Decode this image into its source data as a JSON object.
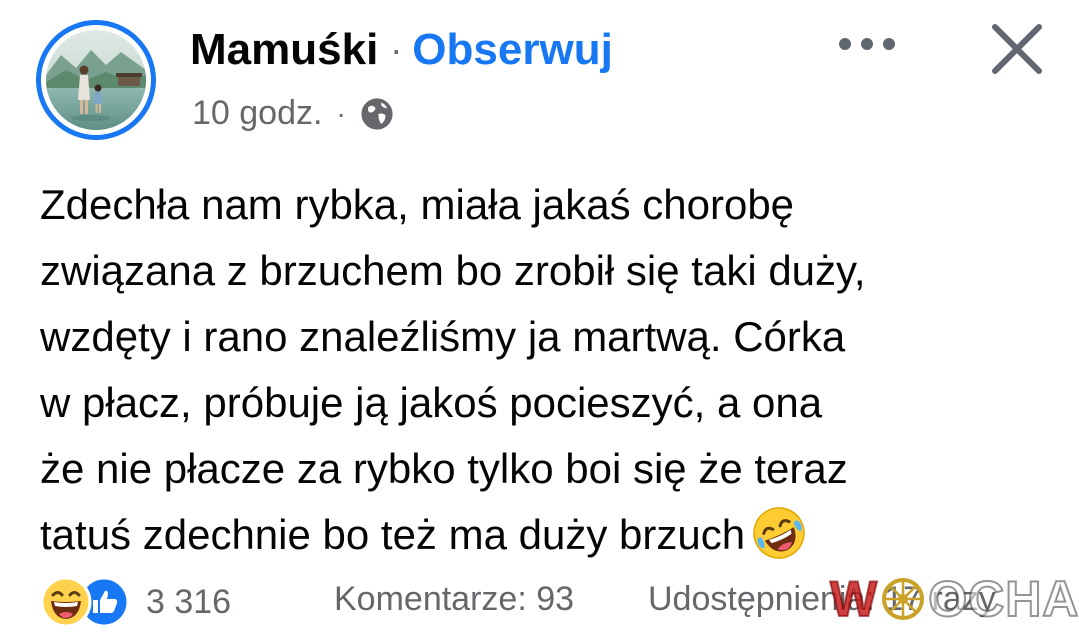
{
  "post": {
    "page_name": "Mamuśki",
    "separator": "·",
    "follow_label": "Obserwuj",
    "time": "10 godz.",
    "meta_separator": "·",
    "privacy_icon": "globe-icon",
    "text": "Zdechła nam rybka, miała jakaś chorobę\nzwiązana z brzuchem bo zrobił się taki duży,\nwzdęty i rano znaleźliśmy ja martwą. Córka\nw płacz, próbuje ją jakoś pocieszyć, a ona\nże nie płacze za rybko tylko boi się że teraz\ntatuś zdechnie bo też ma duży brzuch",
    "text_emoji": "rolling-laughing-emoji"
  },
  "header": {
    "more_icon": "more-options-icon",
    "close_icon": "close-icon"
  },
  "footer": {
    "reaction_icons": [
      "haha-reaction-icon",
      "like-reaction-icon"
    ],
    "reaction_count": "3 316",
    "comments": "Komentarze: 93",
    "shares": "Udostępnienia: 17 razy"
  },
  "watermark": {
    "prefix": "W",
    "suffix": "OCHA"
  },
  "colors": {
    "accent": "#1877f2",
    "secondary_text": "#65676b",
    "primary_text": "#050505"
  }
}
